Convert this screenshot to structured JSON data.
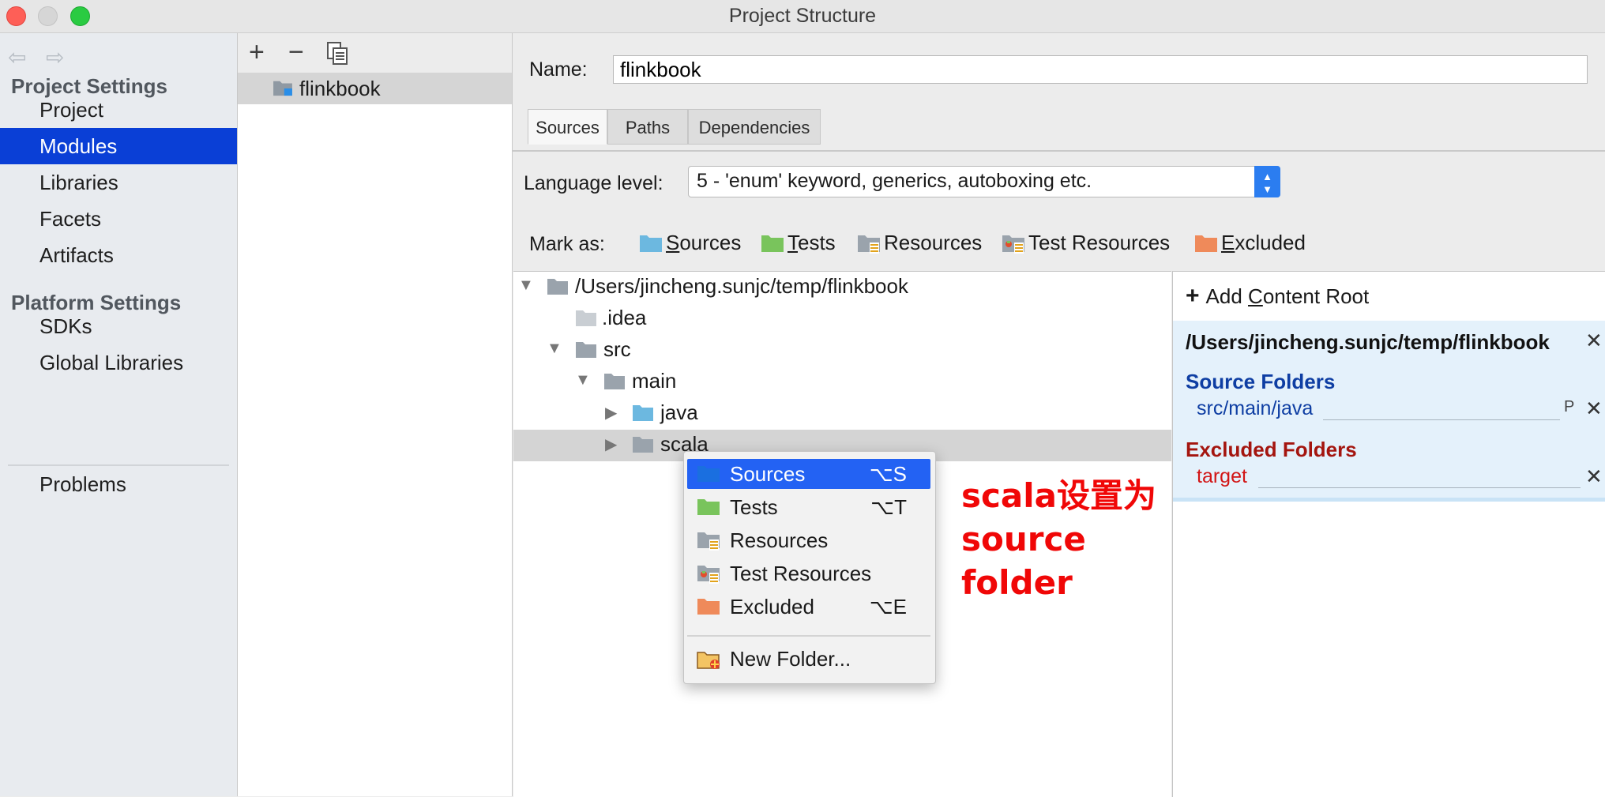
{
  "window": {
    "title": "Project Structure"
  },
  "sidebar": {
    "project_settings_header": "Project Settings",
    "project_items": [
      "Project",
      "Modules",
      "Libraries",
      "Facets",
      "Artifacts"
    ],
    "selected": "Modules",
    "platform_settings_header": "Platform Settings",
    "platform_items": [
      "SDKs",
      "Global Libraries"
    ],
    "problems_label": "Problems"
  },
  "modules_panel": {
    "toolbar": {
      "add": "+",
      "remove": "−"
    },
    "modules": [
      "flinkbook"
    ]
  },
  "module_editor": {
    "name_label": "Name:",
    "name_value": "flinkbook",
    "tabs": [
      "Sources",
      "Paths",
      "Dependencies"
    ],
    "active_tab": "Sources",
    "language_level_label": "Language level:",
    "language_level_value": "5 - 'enum' keyword, generics, autoboxing etc.",
    "mark_as_label": "Mark as:",
    "mark_as": {
      "sources": {
        "mnemonic": "S",
        "rest": "ources"
      },
      "tests": {
        "mnemonic": "T",
        "rest": "ests"
      },
      "resources": "Resources",
      "test_resources": "Test Resources",
      "excluded": {
        "mnemonic": "E",
        "rest": "xcluded"
      }
    }
  },
  "tree": {
    "root": "/Users/jincheng.sunjc/temp/flinkbook",
    "idea": ".idea",
    "src": "src",
    "main": "main",
    "java": "java",
    "scala": "scala"
  },
  "content_root": {
    "add_label_pre": "Add ",
    "add_label_mnemonic": "C",
    "add_label_post": "ontent Root",
    "root_path": "/Users/jincheng.sunjc/temp/flinkbook",
    "source_folders_header": "Source Folders",
    "source_folders": [
      "src/main/java"
    ],
    "source_prefix_badge": "P",
    "excluded_folders_header": "Excluded Folders",
    "excluded_folders": [
      "target"
    ]
  },
  "context_menu": {
    "items": [
      {
        "label": "Sources",
        "shortcut": "⌥S"
      },
      {
        "label": "Tests",
        "shortcut": "⌥T"
      },
      {
        "label": "Resources",
        "shortcut": ""
      },
      {
        "label": "Test Resources",
        "shortcut": ""
      },
      {
        "label": "Excluded",
        "shortcut": "⌥E"
      }
    ],
    "highlighted": "Sources",
    "new_folder": "New Folder..."
  },
  "annotation": {
    "line1": "scala设置为",
    "line2": "source",
    "line3": "folder"
  },
  "colors": {
    "selection_blue": "#0a3fd6",
    "menu_highlight": "#2362f3",
    "sources_folder": "#6cb8e0",
    "tests_folder": "#79c45c",
    "excluded_folder": "#ef8a5a",
    "plain_folder": "#9aa3ac",
    "source_header": "#0e3ea3",
    "excluded_header": "#a4150f",
    "annotation": "#f00707"
  }
}
